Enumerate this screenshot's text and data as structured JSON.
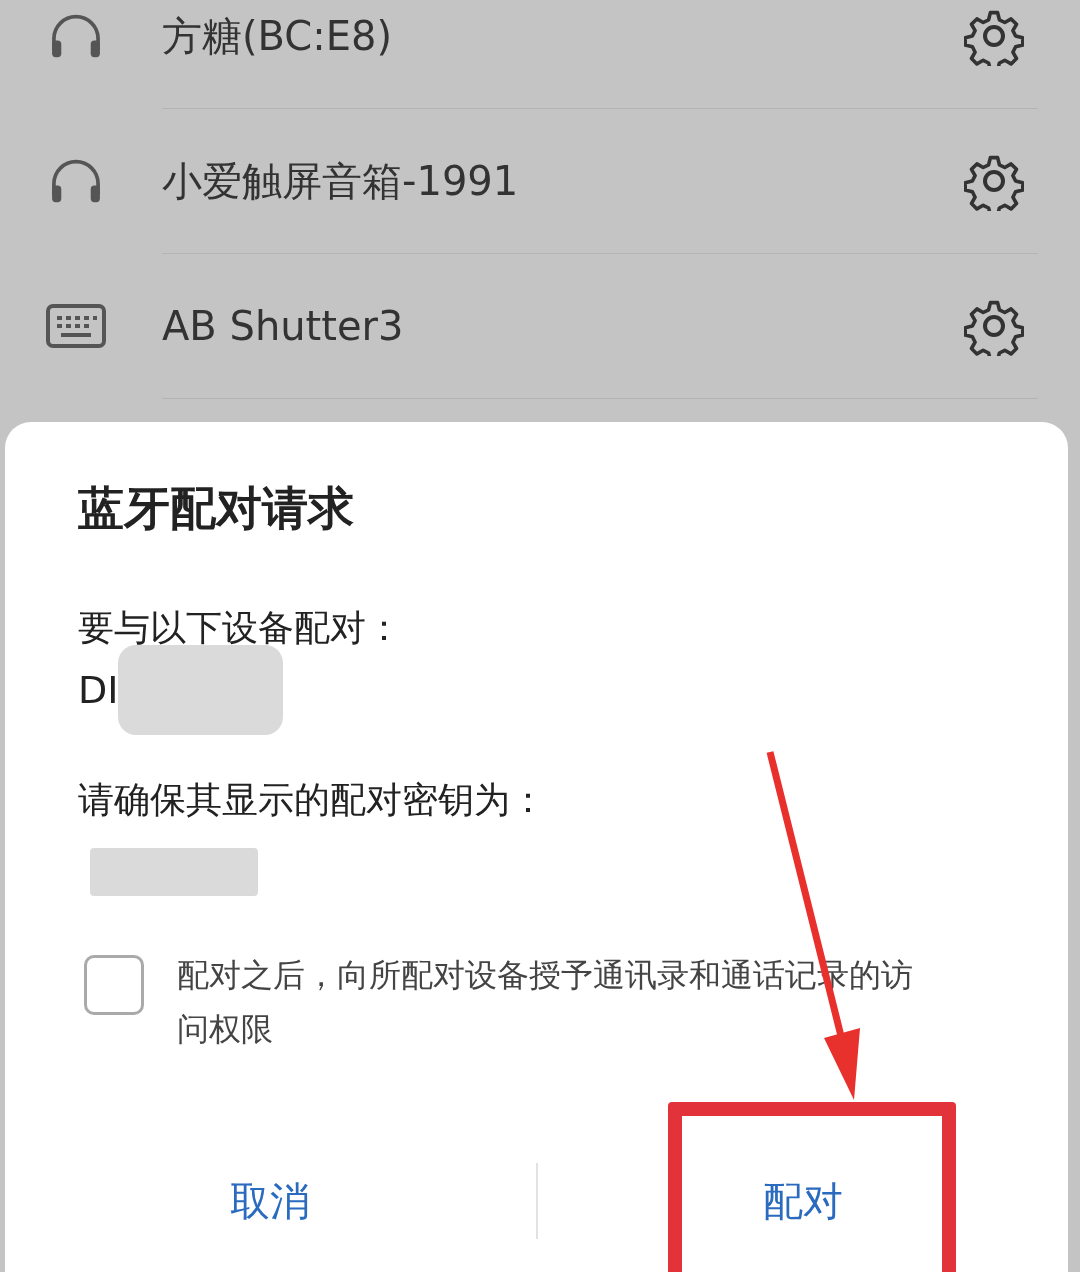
{
  "devices": [
    {
      "kind": "headphones",
      "name": "方糖(BC:E8)"
    },
    {
      "kind": "headphones",
      "name": "小爱触屏音箱-1991"
    },
    {
      "kind": "keyboard",
      "name": "AB Shutter3"
    }
  ],
  "dialog": {
    "title": "蓝牙配对请求",
    "prompt": "要与以下设备配对：",
    "device_name": "DI",
    "passkey_prompt": "请确保其显示的配对密钥为：",
    "contacts_option": {
      "label": "配对之后，向所配对设备授予通讯录和通话记录的访问权限",
      "checked": false
    },
    "buttons": [
      {
        "label": "取消"
      },
      {
        "label": "配对"
      }
    ]
  },
  "annotations": {
    "arrow": true,
    "highlight_box": true
  }
}
